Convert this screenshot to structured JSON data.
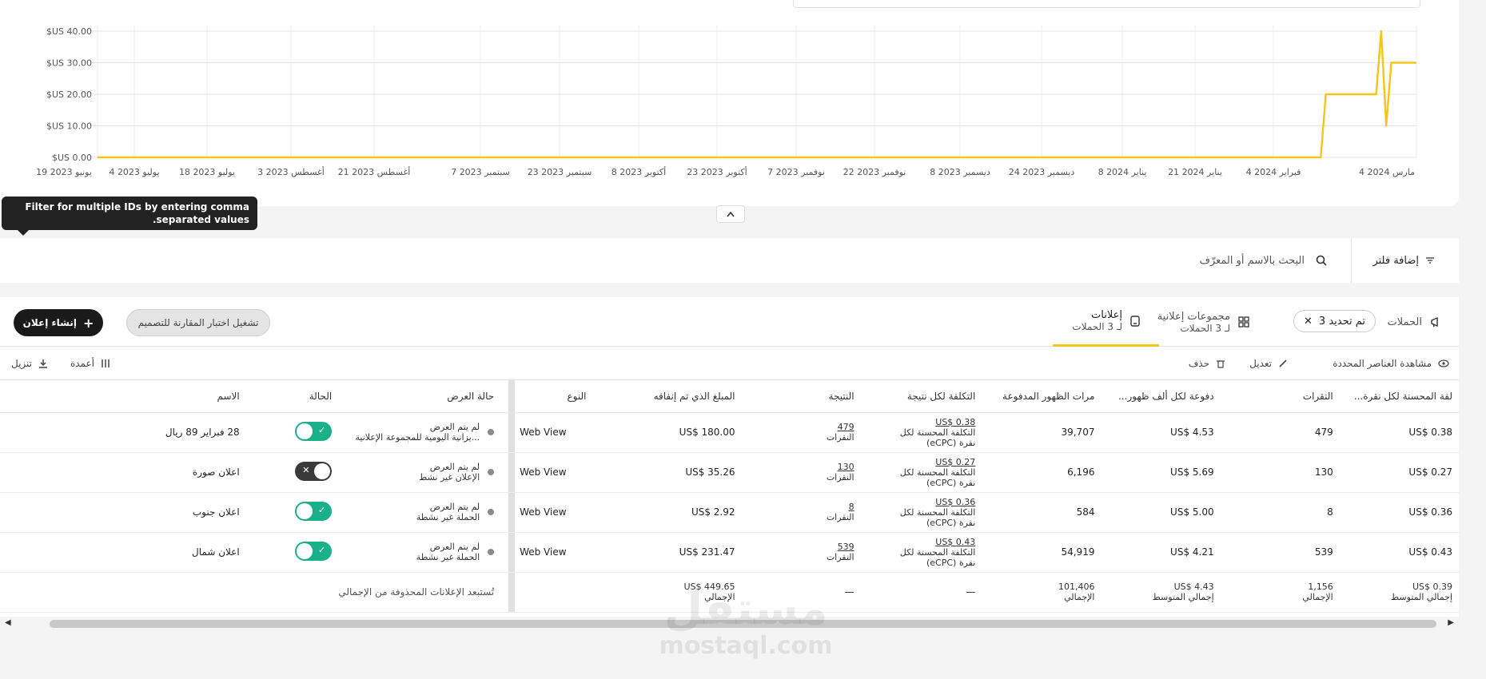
{
  "chart_data": {
    "type": "line",
    "series_color": "#f5c518",
    "grid": true,
    "y_ticks": [
      "$US 0.00",
      "$US 10.00",
      "$US 20.00",
      "$US 30.00",
      "$US 40.00"
    ],
    "ylim": [
      0,
      40
    ],
    "x_tick_labels": [
      "19 يونيو 2023",
      "4 يوليو 2023",
      "18 يوليو 2023",
      "3 أغسطس 2023",
      "21 أغسطس 2023",
      "7 سبتمبر 2023",
      "23 سبتمبر 2023",
      "8 أكتوبر 2023",
      "23 أكتوبر 2023",
      "7 نوفمبر 2023",
      "22 نوفمبر 2023",
      "8 ديسمبر 2023",
      "24 ديسمبر 2023",
      "8 يناير 2024",
      "21 يناير 2024",
      "4 فبراير 2024",
      "4 مارس 2024"
    ],
    "x_range": [
      "2023-06-19",
      "2024-03-07"
    ],
    "points": [
      {
        "x": "2023-06-19",
        "y": 0
      },
      {
        "x": "2024-02-17",
        "y": 0
      },
      {
        "x": "2024-02-18",
        "y": 20
      },
      {
        "x": "2024-02-28",
        "y": 20
      },
      {
        "x": "2024-02-29",
        "y": 40
      },
      {
        "x": "2024-03-01",
        "y": 10
      },
      {
        "x": "2024-03-02",
        "y": 30
      },
      {
        "x": "2024-03-07",
        "y": 30
      }
    ]
  },
  "tooltip": "Filter for multiple IDs by entering comma separated values.",
  "filter": {
    "add_filter": "إضافة فلتر",
    "search_placeholder": "البحث بالاسم أو المعرّف"
  },
  "tabs": {
    "campaigns": "الحملات",
    "chip": "تم تحديد 3",
    "adsets_title": "مجموعات إعلانية",
    "adsets_sub": "لـ 3 الحملات",
    "ads_title": "إعلانات",
    "ads_sub": "لـ 3 الحملات"
  },
  "buttons": {
    "create_ad": "إنشاء إعلان",
    "ab_test": "تشغيل اختبار المقارنة للتصميم"
  },
  "actions": {
    "view_selected": "مشاهدة العناصر المحددة",
    "edit": "تعديل",
    "delete": "حذف",
    "columns": "أعمدة",
    "download": "تنزيل"
  },
  "columns": {
    "name": "الاسم",
    "status": "الحالة",
    "delivery": "حالة العرض",
    "type": "النوع",
    "spent": "المبلغ الذي تم إنفاقه",
    "result": "النتيجة",
    "cost_per_result": "التكلفة لكل نتيجة",
    "impressions": "مرات الظهور المدفوعة",
    "cpm": "...دفوعة لكل ألف ظهور",
    "clicks": "النقرات",
    "ecpc": "...لفة المحسنة لكل نقرة"
  },
  "rows": [
    {
      "name": "28 فبراير 89 ريال",
      "delivery_1": "لم يتم العرض",
      "delivery_2": "...يزانية اليومية للمجموعة الإعلانية",
      "type": "Web View",
      "spent": "US$ 180.00",
      "result": "479",
      "result_label": "النقرات",
      "cpr": "US$ 0.38",
      "cpr_label": "التكلفة المحسنة لكل نقرة (eCPC)",
      "impressions": "39,707",
      "cpm": "US$ 4.53",
      "clicks": "479",
      "ecpc": "US$ 0.38"
    },
    {
      "name": "اعلان صورة",
      "delivery_1": "لم يتم العرض",
      "delivery_2": "الإعلان غير نشط",
      "type": "Web View",
      "spent": "US$ 35.26",
      "result": "130",
      "result_label": "النقرات",
      "cpr": "US$ 0.27",
      "cpr_label": "التكلفة المحسنة لكل نقرة (eCPC)",
      "impressions": "6,196",
      "cpm": "US$ 5.69",
      "clicks": "130",
      "ecpc": "US$ 0.27"
    },
    {
      "name": "اعلان جنوب",
      "delivery_1": "لم يتم العرض",
      "delivery_2": "الحملة غير نشطة",
      "type": "Web View",
      "spent": "US$ 2.92",
      "result": "8",
      "result_label": "النقرات",
      "cpr": "US$ 0.36",
      "cpr_label": "التكلفة المحسنة لكل نقرة (eCPC)",
      "impressions": "584",
      "cpm": "US$ 5.00",
      "clicks": "8",
      "ecpc": "US$ 0.36"
    },
    {
      "name": "اعلان شمال",
      "delivery_1": "لم يتم العرض",
      "delivery_2": "الحملة غير نشطة",
      "type": "Web View",
      "spent": "US$ 231.47",
      "result": "539",
      "result_label": "النقرات",
      "cpr": "US$ 0.43",
      "cpr_label": "التكلفة المحسنة لكل نقرة (eCPC)",
      "impressions": "54,919",
      "cpm": "US$ 4.21",
      "clicks": "539",
      "ecpc": "US$ 0.43"
    }
  ],
  "totals": {
    "note": "تُستبعد الإعلانات المحذوفة من الإجمالي",
    "spent": "US$ 449.65",
    "spent_label": "الإجمالي",
    "result": "—",
    "cpr": "—",
    "impressions": "101,406",
    "impressions_label": "الإجمالي",
    "cpm": "US$ 4.43",
    "cpm_label": "إجمالي المتوسط",
    "clicks": "1,156",
    "clicks_label": "الإجمالي",
    "ecpc": "US$ 0.39",
    "ecpc_label": "إجمالي المتوسط"
  },
  "watermark": {
    "logo": "مستقل",
    "url": "mostaql.com"
  }
}
